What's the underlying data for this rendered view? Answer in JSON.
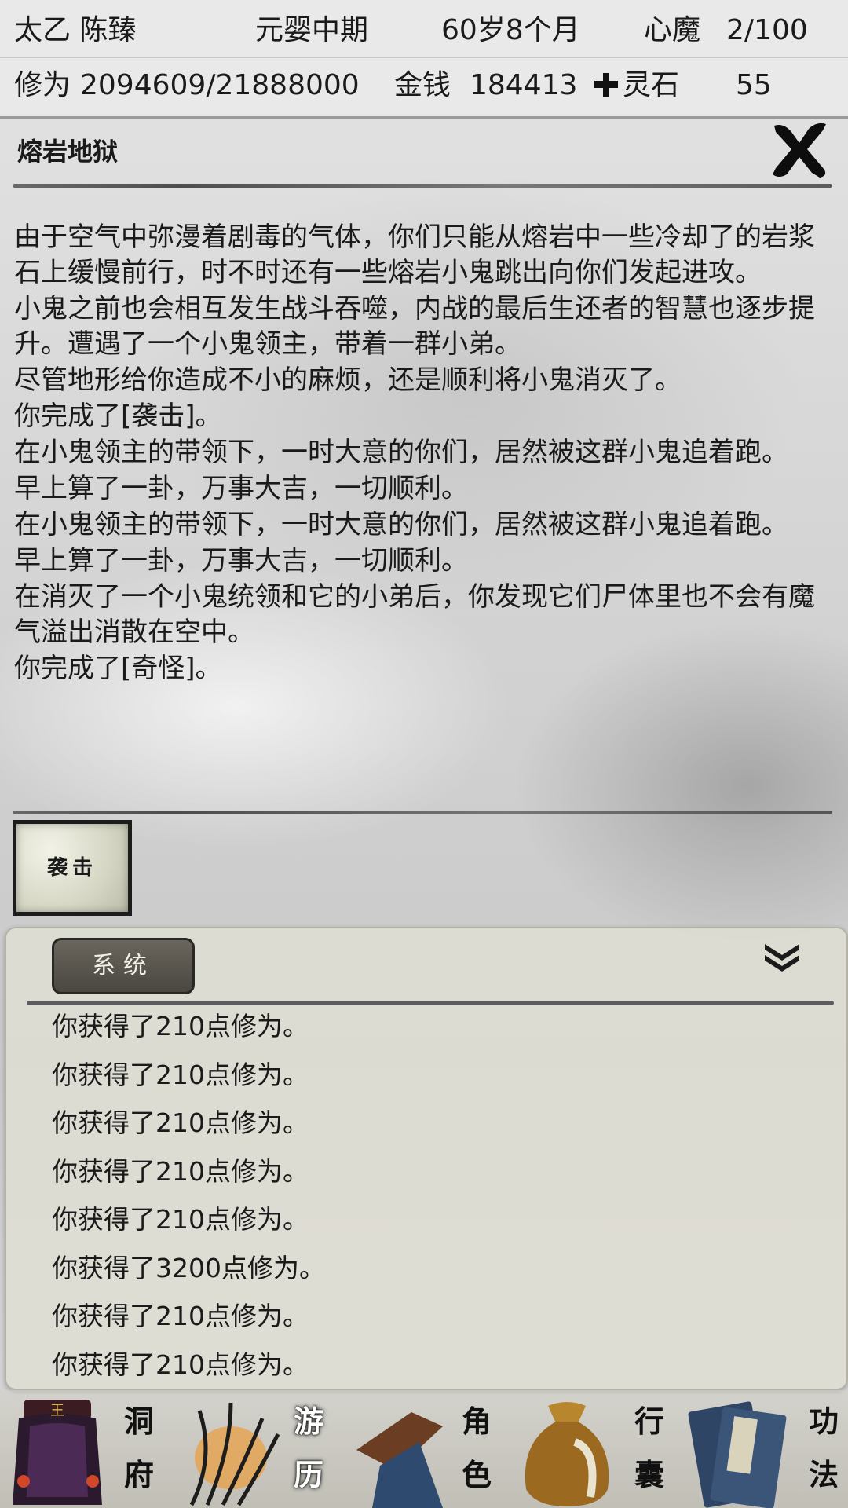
{
  "status": {
    "name": "太乙 陈臻",
    "realm": "元婴中期",
    "age": "60岁8个月",
    "demon_label": "心魔",
    "demon_value": "2/100",
    "cultivation_label": "修为",
    "cultivation_value": "2094609/21888000",
    "money_label": "金钱",
    "money_value": "184413",
    "spirit_stone_label": "灵石",
    "spirit_stone_value": "55"
  },
  "event": {
    "title": "熔岩地狱",
    "paragraphs": [
      "由于空气中弥漫着剧毒的气体，你们只能从熔岩中一些冷却了的岩浆石上缓慢前行，时不时还有一些熔岩小鬼跳出向你们发起进攻。",
      "小鬼之前也会相互发生战斗吞噬，内战的最后生还者的智慧也逐步提升。遭遇了一个小鬼领主，带着一群小弟。",
      "尽管地形给你造成不小的麻烦，还是顺利将小鬼消灭了。",
      "你完成了[袭击]。",
      "在小鬼领主的带领下，一时大意的你们，居然被这群小鬼追着跑。",
      "早上算了一卦，万事大吉，一切顺利。",
      "在小鬼领主的带领下，一时大意的你们，居然被这群小鬼追着跑。",
      "早上算了一卦，万事大吉，一切顺利。",
      "在消灭了一个小鬼统领和它的小弟后，你发现它们尸体里也不会有魔气溢出消散在空中。",
      "你完成了[奇怪]。"
    ],
    "tag_card": "袭击"
  },
  "log": {
    "tab_label": "系统",
    "entries": [
      "你获得了210点修为。",
      "你获得了210点修为。",
      "你获得了210点修为。",
      "你获得了210点修为。",
      "你获得了210点修为。",
      "你获得了3200点修为。",
      "你获得了210点修为。",
      "你获得了210点修为。"
    ]
  },
  "nav": {
    "cave": "洞府",
    "travel": "游历",
    "character": "角色",
    "bag": "行囊",
    "skills": "功法"
  },
  "icons": {
    "close": "close-icon",
    "collapse": "chevron-double-down-icon",
    "spirit_stone": "spirit-stone-icon"
  }
}
